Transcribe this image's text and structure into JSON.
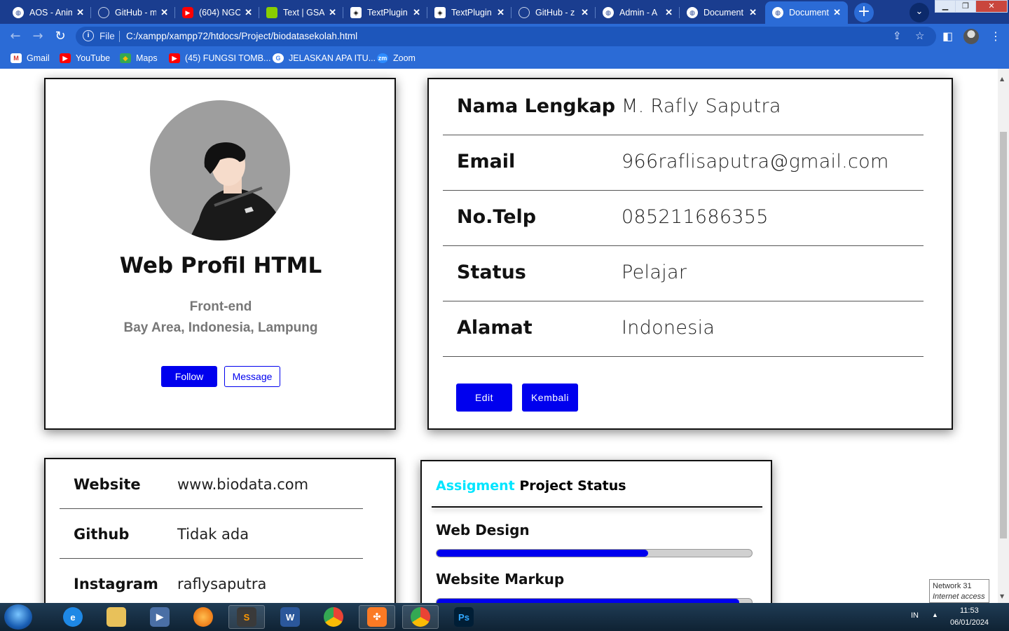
{
  "browser": {
    "tabs": [
      {
        "title": "AOS - Anim",
        "favicon": "globe-icon"
      },
      {
        "title": "GitHub - m",
        "favicon": "github-icon"
      },
      {
        "title": "(604) NGO",
        "favicon": "youtube-icon"
      },
      {
        "title": "Text | GSA",
        "favicon": "clover-icon"
      },
      {
        "title": "TextPlugin",
        "favicon": "codepen-icon"
      },
      {
        "title": "TextPlugin",
        "favicon": "codepen-icon"
      },
      {
        "title": "GitHub - z",
        "favicon": "github-icon"
      },
      {
        "title": "Admin - A",
        "favicon": "globe-icon"
      },
      {
        "title": "Document",
        "favicon": "globe-icon"
      },
      {
        "title": "Document",
        "favicon": "globe-icon"
      }
    ],
    "url_scheme": "File",
    "url": "C:/xampp/xampp72/htdocs/Project/biodatasekolah.html",
    "bookmarks": [
      {
        "label": "Gmail",
        "icon": "gmail-icon"
      },
      {
        "label": "YouTube",
        "icon": "youtube-icon"
      },
      {
        "label": "Maps",
        "icon": "maps-icon"
      },
      {
        "label": "(45) FUNGSI TOMB...",
        "icon": "youtube-icon"
      },
      {
        "label": "JELASKAN APA ITU...",
        "icon": "google-icon"
      },
      {
        "label": "Zoom",
        "icon": "zoom-icon"
      }
    ],
    "zoom_icon_text": "zm"
  },
  "profile": {
    "name": "Web Profil HTML",
    "role": "Front-end",
    "location": "Bay Area, Indonesia, Lampung",
    "follow_label": "Follow",
    "message_label": "Message"
  },
  "biodata": {
    "rows": [
      {
        "label": "Nama Lengkap",
        "value": "M. Rafly Saputra"
      },
      {
        "label": "Email",
        "value": "966raflisaputra@gmail.com"
      },
      {
        "label": "No.Telp",
        "value": "085211686355"
      },
      {
        "label": "Status",
        "value": "Pelajar"
      },
      {
        "label": "Alamat",
        "value": "Indonesia"
      }
    ],
    "edit_label": "Edit",
    "back_label": "Kembali"
  },
  "social": {
    "rows": [
      {
        "label": "Website",
        "value": "www.biodata.com"
      },
      {
        "label": "Github",
        "value": "Tidak ada"
      },
      {
        "label": "Instagram",
        "value": "raflysaputra"
      }
    ]
  },
  "project_status": {
    "accent_word": "Assigment",
    "title_rest": "Project Status",
    "skills": [
      {
        "name": "Web Design",
        "progress": 0.67
      },
      {
        "name": "Website Markup",
        "progress": 0.96
      }
    ]
  },
  "taskbar": {
    "apps": [
      "internet-explorer-icon",
      "file-explorer-icon",
      "media-player-icon",
      "firefox-icon",
      "sublime-text-icon",
      "word-icon",
      "chrome-icon",
      "xampp-icon",
      "chrome-icon",
      "photoshop-icon"
    ],
    "word_glyph": "W",
    "photoshop_glyph": "Ps",
    "language": "IN",
    "time": "11:53",
    "date": "06/01/2024",
    "tooltip_title": "Network  31",
    "tooltip_text": "Internet access"
  },
  "colors": {
    "chrome_dark": "#1a3d8f",
    "chrome": "#2b6bd6",
    "button_blue": "#0000ee",
    "accent_cyan": "#00e5ff"
  }
}
